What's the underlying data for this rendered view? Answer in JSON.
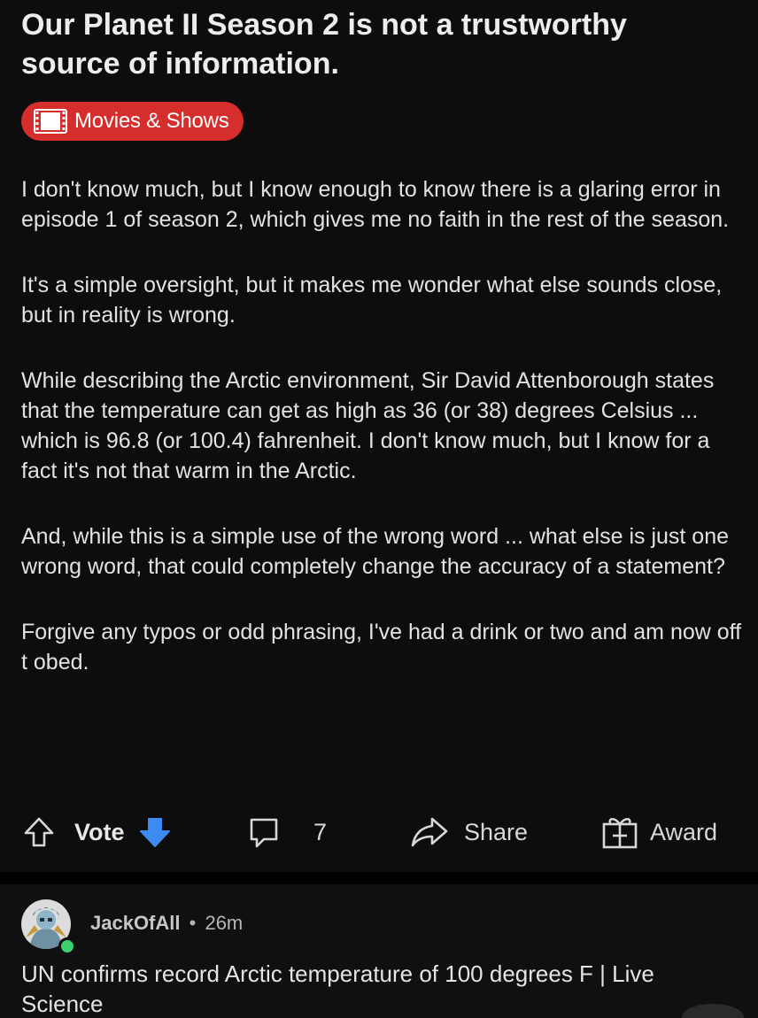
{
  "post": {
    "title": "Our Planet II Season 2 is not a trustworthy source of information.",
    "flair": {
      "label": "Movies & Shows",
      "icon": "film-icon",
      "color": "#d62d2d"
    },
    "paragraphs": [
      "I don't know much, but I know enough to know there is a glaring error in episode 1 of season 2, which gives me no faith in the rest of the season.",
      "It's a simple oversight, but it makes me wonder what else sounds close, but in reality is wrong.",
      "While describing the Arctic environment, Sir David Attenborough states that the temperature can get as high as 36 (or 38) degrees Celsius ... which is 96.8 (or 100.4) fahrenheit. I don't know much, but I know for a fact it's not that warm in the Arctic.",
      "And, while this is a simple use of the wrong word ... what else is just one wrong word, that could completely change the accuracy of a statement?",
      "Forgive any typos or odd phrasing, I've had a drink or two and am now off t obed."
    ]
  },
  "actions": {
    "vote_label": "Vote",
    "comment_count": "7",
    "share_label": "Share",
    "award_label": "Award",
    "icons": {
      "upvote": "upvote-arrow-icon",
      "downvote": "downvote-arrow-icon",
      "comment": "comment-bubble-icon",
      "share": "share-arrow-icon",
      "award": "gift-box-icon"
    },
    "colors": {
      "downvote": "#3d8bf0"
    }
  },
  "comment": {
    "username": "JackOfAll",
    "separator": "•",
    "time": "26m",
    "text": "UN confirms record Arctic temperature of 100 degrees F | Live Science",
    "online_indicator_color": "#3bd16f"
  }
}
